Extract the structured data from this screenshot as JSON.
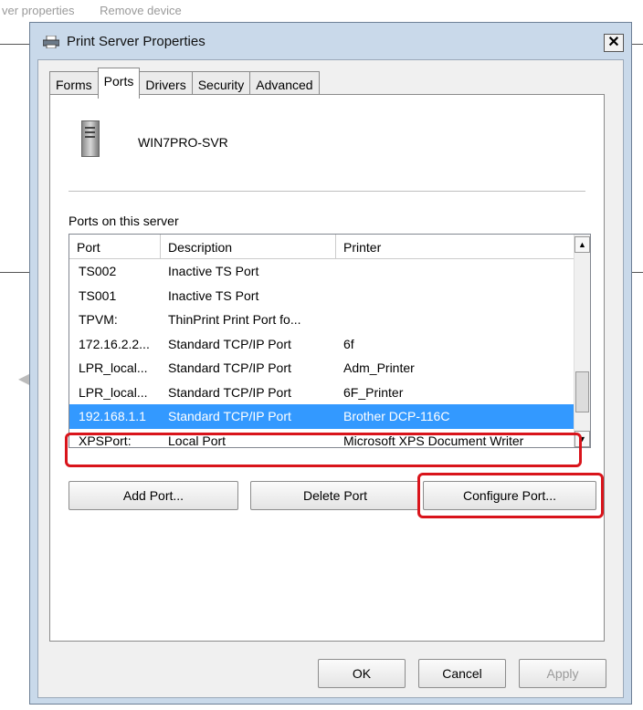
{
  "background": {
    "links": [
      "ver properties",
      "Remove device"
    ]
  },
  "window": {
    "title": "Print Server Properties",
    "close_label": "✕",
    "tabs": [
      {
        "label": "Forms",
        "active": false
      },
      {
        "label": "Ports",
        "active": true
      },
      {
        "label": "Drivers",
        "active": false
      },
      {
        "label": "Security",
        "active": false
      },
      {
        "label": "Advanced",
        "active": false
      }
    ],
    "server_name": "WIN7PRO-SVR",
    "ports_label": "Ports on this server",
    "columns": {
      "port": "Port",
      "description": "Description",
      "printer": "Printer"
    },
    "rows": [
      {
        "port": "TS002",
        "description": "Inactive TS Port",
        "printer": ""
      },
      {
        "port": "TS001",
        "description": "Inactive TS Port",
        "printer": ""
      },
      {
        "port": "TPVM:",
        "description": "ThinPrint Print Port fo...",
        "printer": ""
      },
      {
        "port": "172.16.2.2...",
        "description": "Standard TCP/IP Port",
        "printer": "6f"
      },
      {
        "port": "LPR_local...",
        "description": "Standard TCP/IP Port",
        "printer": "Adm_Printer"
      },
      {
        "port": "LPR_local...",
        "description": "Standard TCP/IP Port",
        "printer": "6F_Printer"
      },
      {
        "port": "192.168.1.1",
        "description": "Standard TCP/IP Port",
        "printer": "Brother DCP-116C",
        "selected": true
      },
      {
        "port": "XPSPort:",
        "description": "Local Port",
        "printer": "Microsoft XPS Document Writer"
      }
    ],
    "buttons": {
      "add_port": "Add Port...",
      "delete_port": "Delete Port",
      "configure_port": "Configure Port...",
      "ok": "OK",
      "cancel": "Cancel",
      "apply": "Apply"
    },
    "colors": {
      "selection": "#3399ff",
      "highlight_frame": "#d9141b"
    }
  }
}
